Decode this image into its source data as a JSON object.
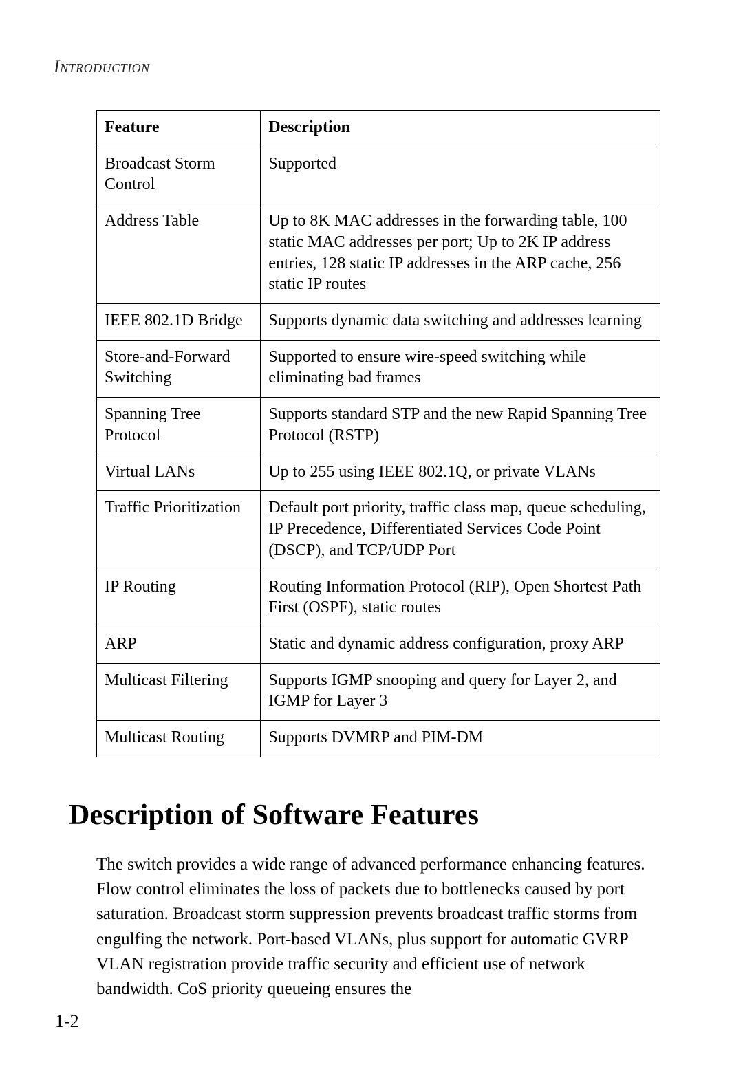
{
  "running_head": "Introduction",
  "table": {
    "headers": {
      "feature": "Feature",
      "description": "Description"
    },
    "rows": [
      {
        "feature": "Broadcast Storm Control",
        "description": "Supported"
      },
      {
        "feature": "Address Table",
        "description": "Up to 8K MAC addresses in the forwarding table, 100 static MAC addresses per port; Up to 2K IP address entries, 128 static IP addresses in the ARP cache, 256 static IP routes"
      },
      {
        "feature": "IEEE 802.1D Bridge",
        "description": "Supports dynamic data switching and addresses learning"
      },
      {
        "feature": "Store-and-Forward Switching",
        "description": "Supported to ensure wire-speed switching while eliminating bad frames"
      },
      {
        "feature": "Spanning Tree Protocol",
        "description": "Supports standard STP and the new Rapid Spanning Tree Protocol (RSTP)"
      },
      {
        "feature": "Virtual LANs",
        "description": "Up to 255 using IEEE 802.1Q, or private VLANs"
      },
      {
        "feature": "Traffic Prioritization",
        "description": "Default port priority, traffic class map, queue scheduling, IP Precedence, Differentiated Services Code Point (DSCP), and TCP/UDP Port"
      },
      {
        "feature": "IP Routing",
        "description": "Routing Information Protocol (RIP), Open Shortest Path First (OSPF), static routes"
      },
      {
        "feature": "ARP",
        "description": "Static and dynamic address configuration, proxy ARP"
      },
      {
        "feature": "Multicast Filtering",
        "description": "Supports IGMP snooping and query for Layer 2, and IGMP for Layer 3"
      },
      {
        "feature": "Multicast Routing",
        "description": "Supports DVMRP and PIM-DM"
      }
    ]
  },
  "section_heading": "Description of Software Features",
  "body_paragraph": "The switch provides a wide range of advanced performance enhancing features. Flow control eliminates the loss of packets due to bottlenecks caused by port saturation. Broadcast storm suppression prevents broadcast traffic storms from engulfing the network. Port-based VLANs, plus support for automatic GVRP VLAN registration provide traffic security and efficient use of network bandwidth. CoS priority queueing ensures the",
  "page_number": "1-2"
}
